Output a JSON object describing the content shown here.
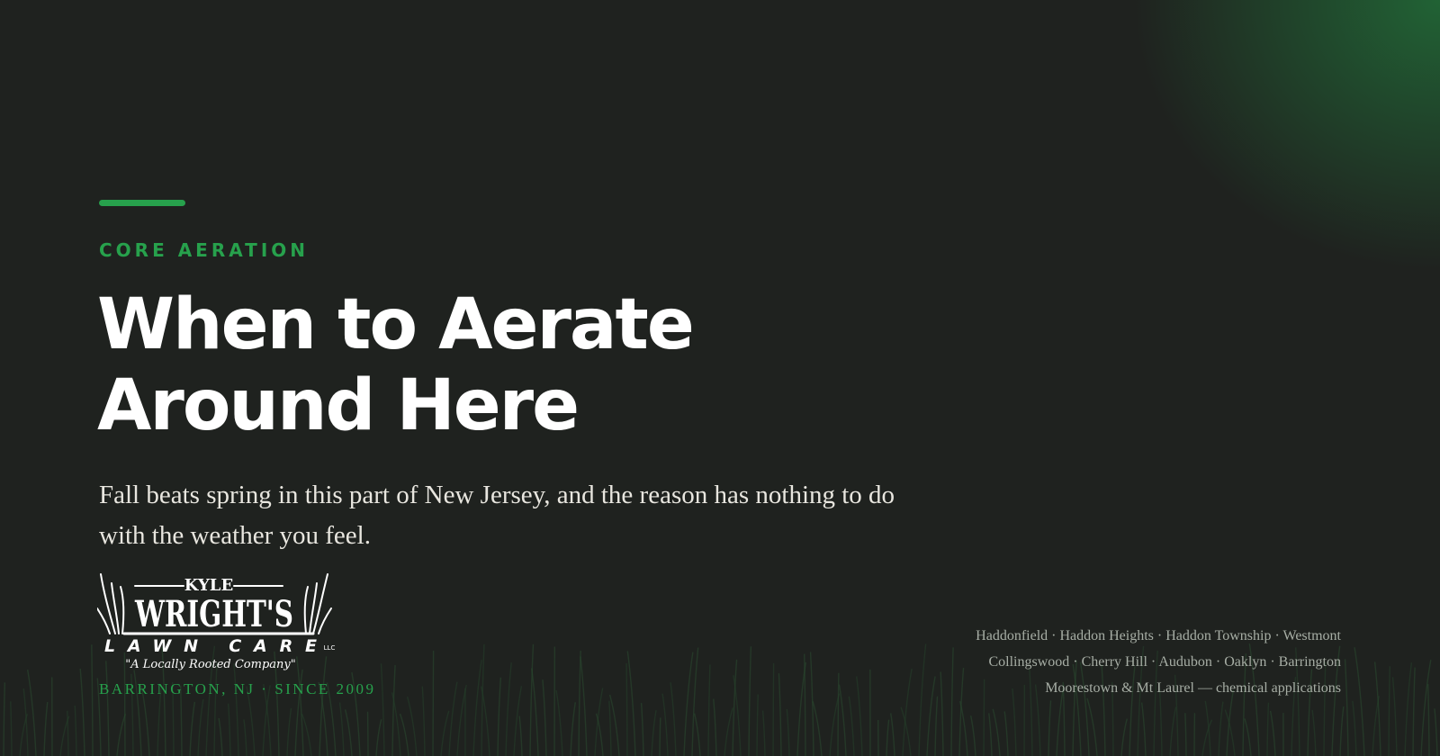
{
  "colors": {
    "background": "#1f221f",
    "accent": "#27a14c",
    "heading": "#ffffff",
    "body_text": "#e8e6df",
    "muted_text": "#a7aea5"
  },
  "hero": {
    "eyebrow": "CORE AERATION",
    "title_line1": "When to Aerate",
    "title_line2": "Around Here",
    "lede": "Fall beats spring in this part of New Jersey, and the reason has nothing to do with the weather you feel."
  },
  "brand": {
    "logo_top": "KYLE",
    "logo_name": "WRIGHT'S",
    "logo_sub": "LAWN CARE",
    "logo_suffix": "LLC",
    "logo_slogan": "\"A Locally Rooted Company\"",
    "tagline": "BARRINGTON, NJ · SINCE 2009"
  },
  "service_areas": {
    "line1": "Haddonfield · Haddon Heights · Haddon Township · Westmont",
    "line2": "Collingswood · Cherry Hill · Audubon · Oaklyn · Barrington",
    "line3": "Moorestown & Mt Laurel — chemical applications"
  }
}
